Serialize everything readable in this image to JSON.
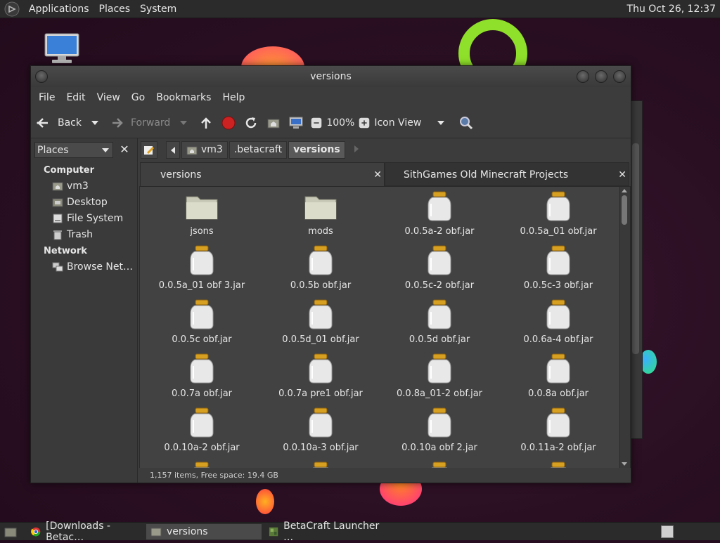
{
  "top_panel": {
    "menus": [
      "Applications",
      "Places",
      "System"
    ],
    "clock": "Thu Oct 26, 12:37"
  },
  "window": {
    "title": "versions",
    "menubar": [
      "File",
      "Edit",
      "View",
      "Go",
      "Bookmarks",
      "Help"
    ],
    "toolbar": {
      "back": "Back",
      "forward": "Forward",
      "zoom": "100%",
      "view_mode": "Icon View"
    },
    "sidebar": {
      "selector": "Places",
      "sections": [
        {
          "heading": "Computer",
          "items": [
            "vm3",
            "Desktop",
            "File System",
            "Trash"
          ]
        },
        {
          "heading": "Network",
          "items": [
            "Browse Net…"
          ]
        }
      ]
    },
    "path": [
      "vm3",
      ".betacraft",
      "versions"
    ],
    "tabs": [
      "versions",
      "SithGames Old Minecraft Projects"
    ],
    "files": [
      "jsons",
      "mods",
      "0.0.5a-2 obf.jar",
      "0.0.5a_01 obf.jar",
      "0.0.5a_01 obf 3.jar",
      "0.0.5b obf.jar",
      "0.0.5c-2 obf.jar",
      "0.0.5c-3 obf.jar",
      "0.0.5c obf.jar",
      "0.0.5d_01 obf.jar",
      "0.0.5d obf.jar",
      "0.0.6a-4 obf.jar",
      "0.0.7a obf.jar",
      "0.0.7a pre1 obf.jar",
      "0.0.8a_01-2 obf.jar",
      "0.0.8a obf.jar",
      "0.0.10a-2 obf.jar",
      "0.0.10a-3 obf.jar",
      "0.0.10a obf 2.jar",
      "0.0.11a-2 obf.jar"
    ],
    "status": "1,157 items, Free space: 19.4 GB"
  },
  "taskbar": {
    "tasks": [
      "[Downloads - Betac…",
      "versions",
      "BetaCraft Launcher …"
    ]
  }
}
